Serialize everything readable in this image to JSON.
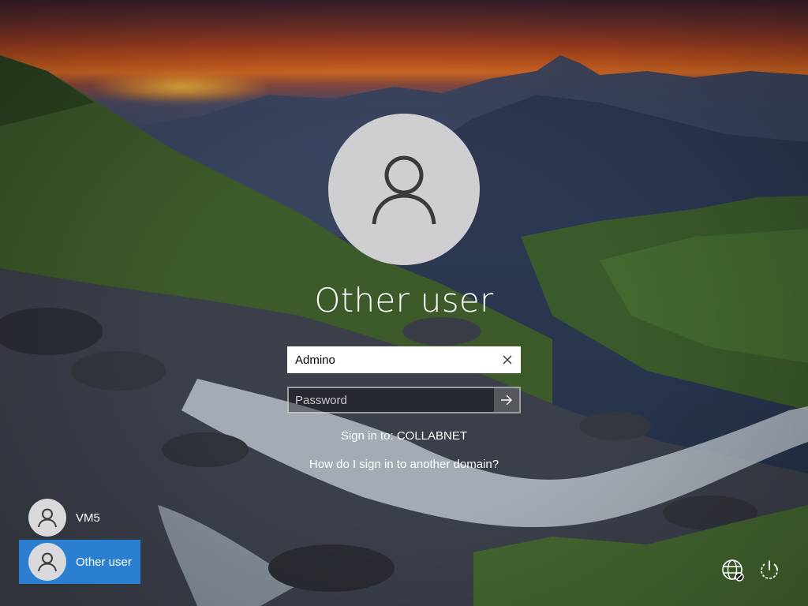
{
  "login": {
    "user_display_name": "Other user",
    "username_value": "Admino",
    "password_placeholder": "Password",
    "sign_in_to": "Sign in to: COLLABNET",
    "domain_help_link": "How do I sign in to another domain?"
  },
  "user_list": [
    {
      "label": "VM5",
      "selected": false
    },
    {
      "label": "Other user",
      "selected": true
    }
  ],
  "icons": {
    "avatar": "person-icon",
    "clear": "close-icon",
    "submit": "arrow-right-icon",
    "network": "network-globe-icon",
    "power": "power-icon"
  },
  "colors": {
    "selected_tile": "#2b7fd0",
    "avatar_bg": "#cfcfd1"
  }
}
